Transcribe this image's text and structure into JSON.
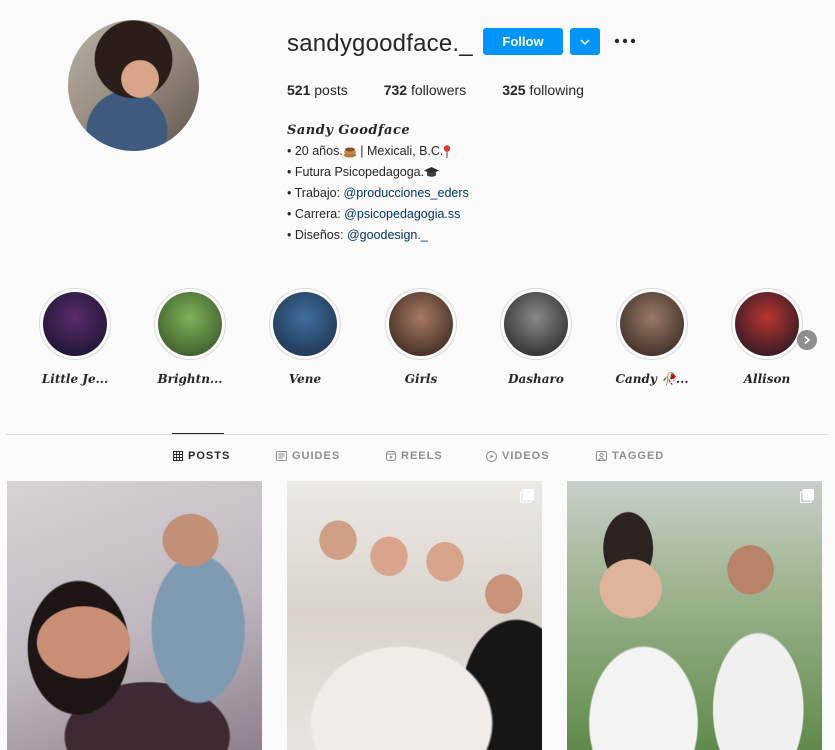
{
  "profile": {
    "username": "sandygoodface._",
    "follow_label": "Follow",
    "stats": [
      {
        "count": "521",
        "label": "posts"
      },
      {
        "count": "732",
        "label": "followers"
      },
      {
        "count": "325",
        "label": "following"
      }
    ],
    "bio": {
      "name": "Sandy Goodface",
      "line1": "• 20 años.",
      "line1b": " | Mexicali, B.C.",
      "line2": "• Futura Psicopedagoga.",
      "line3_prefix": "• Trabajo: ",
      "line3_link": "@producciones_eders",
      "line4_prefix": "• Carrera: ",
      "line4_link": "@psicopedagogia.ss",
      "line5_prefix": "• Diseños: ",
      "line5_link": "@goodesign._"
    }
  },
  "highlights": [
    {
      "label": "Little Je...",
      "colors": [
        "#5a2b6b",
        "#1c1433"
      ]
    },
    {
      "label": "Brightn...",
      "colors": [
        "#7fb35a",
        "#3b5a2a"
      ]
    },
    {
      "label": "Vene",
      "colors": [
        "#3f6e9e",
        "#1f3550"
      ]
    },
    {
      "label": "Girls",
      "colors": [
        "#a87a62",
        "#3d2a22"
      ]
    },
    {
      "label": "Dasharo",
      "colors": [
        "#8a8a86",
        "#2c2c2c"
      ]
    },
    {
      "label": "Candy 🥀...",
      "colors": [
        "#9a7a66",
        "#3a2c26"
      ]
    },
    {
      "label": "Allison",
      "colors": [
        "#b9352e",
        "#2a1a26"
      ]
    }
  ],
  "tabs": [
    {
      "label": "POSTS",
      "icon": "grid-icon",
      "active": true
    },
    {
      "label": "GUIDES",
      "icon": "guides-icon",
      "active": false
    },
    {
      "label": "REELS",
      "icon": "reels-icon",
      "active": false
    },
    {
      "label": "VIDEOS",
      "icon": "play-icon",
      "active": false
    },
    {
      "label": "TAGGED",
      "icon": "tagged-icon",
      "active": false
    }
  ],
  "colors": {
    "accent": "#0095f6",
    "link": "#00376b",
    "text": "#262626",
    "muted": "#8e8e8e",
    "border": "#dbdbdb",
    "background": "#fafafa"
  }
}
